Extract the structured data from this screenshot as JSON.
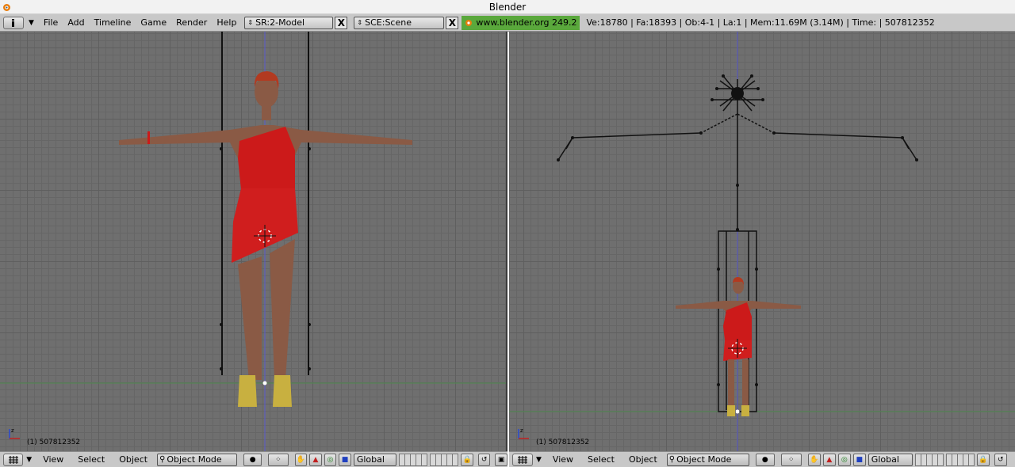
{
  "window": {
    "title": "Blender"
  },
  "info_header": {
    "menus": [
      "File",
      "Add",
      "Timeline",
      "Game",
      "Render",
      "Help"
    ],
    "screen": "SR:2-Model",
    "scene": "SCE:Scene",
    "url": "www.blender.org 249.2",
    "stats": "Ve:18780 | Fa:18393 | Ob:4-1 | La:1  | Mem:11.69M (3.14M)  | Time: | 507812352",
    "close_label": "X"
  },
  "viewport_left": {
    "frame_label": "(1) 507812352"
  },
  "viewport_right": {
    "frame_label": "(1) 507812352"
  },
  "header_left": {
    "view": "View",
    "select": "Select",
    "object": "Object",
    "mode": "Object Mode",
    "orientation": "Global"
  },
  "header_right": {
    "view": "View",
    "select": "Select",
    "object": "Object",
    "mode": "Object Mode",
    "orientation": "Global"
  },
  "colors": {
    "viewport_bg": "#6f6f6f",
    "header_bg": "#c8c8c8",
    "url_bg": "#5aa83c",
    "dress": "#cc1a1a",
    "skin": "#8a5a45",
    "shoes": "#c8b040"
  },
  "icons": [
    "blender-logo-icon",
    "info-editor-icon",
    "view3d-editor-icon",
    "pivot-icon",
    "hand-icon",
    "translate-icon",
    "rotate-icon",
    "scale-icon",
    "lock-icon",
    "render-icon"
  ]
}
